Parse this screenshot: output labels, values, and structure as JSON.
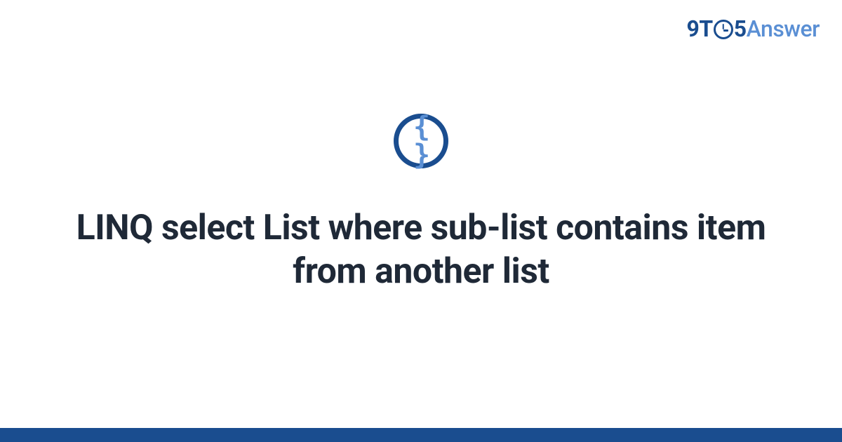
{
  "logo": {
    "prefix": "9T",
    "suffix": "5",
    "word": "Answer"
  },
  "icon": {
    "braces": "{ }"
  },
  "title": "LINQ select List where sub-list contains item from another list"
}
